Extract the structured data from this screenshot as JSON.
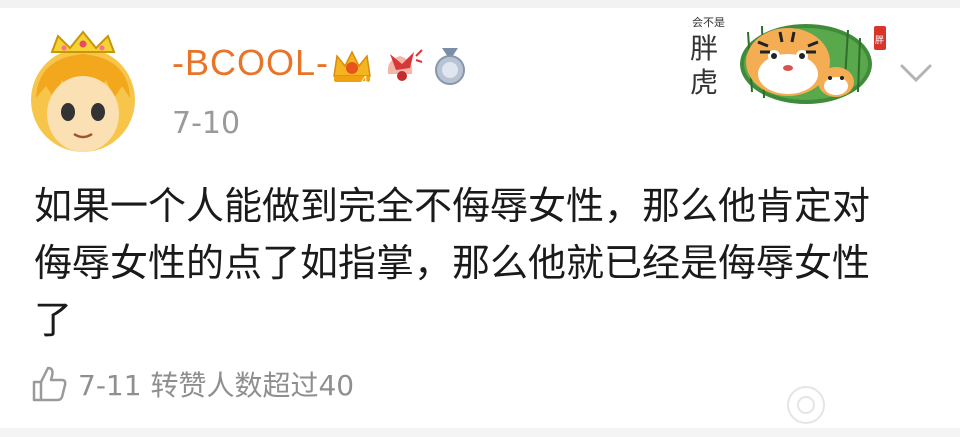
{
  "post": {
    "username": "-BCOOL-",
    "date": "7-10",
    "body_lines": [
      "如果一个人能做到完全不侮辱女性，那么他肯定对",
      "侮辱女性的点了如指掌，那么他就已经是侮辱女性",
      "了"
    ],
    "reply_info": "7-11 转赞人数超过40",
    "vip_level": "4"
  },
  "sticker": {
    "text_top": "会不是",
    "text_main_1": "胖",
    "text_main_2": "虎",
    "seal": "胖"
  },
  "badges": [
    "crown-vip-badge",
    "gift-badge",
    "medal-badge"
  ],
  "colors": {
    "username": "#e8742a",
    "meta": "#9a9a9a",
    "body": "#1a1a1a"
  }
}
